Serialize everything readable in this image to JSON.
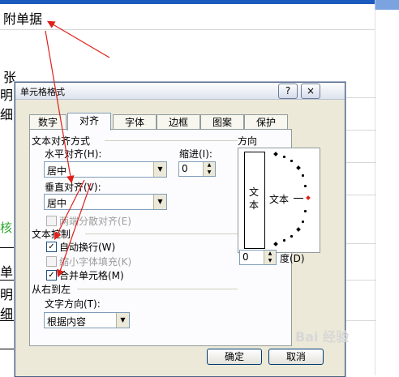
{
  "sheet": {
    "heading": "附单据",
    "cell_zhang": "张",
    "cell_mingxi_fragment": "明细",
    "cell_he": "核",
    "cell_dan": "单",
    "cell_ming_fragment": "明细"
  },
  "dialog": {
    "title": "单元格格式",
    "help_label": "?",
    "close_label": "×",
    "tabs": [
      {
        "label": "数字",
        "active": false
      },
      {
        "label": "对齐",
        "active": true
      },
      {
        "label": "字体",
        "active": false
      },
      {
        "label": "边框",
        "active": false
      },
      {
        "label": "图案",
        "active": false
      },
      {
        "label": "保护",
        "active": false
      }
    ],
    "text_alignment": {
      "section_label": "文本对齐方式",
      "horizontal_label": "水平对齐(H):",
      "horizontal_value": "居中",
      "indent_label": "缩进(I):",
      "indent_value": "0",
      "vertical_label": "垂直对齐(V):",
      "vertical_value": "居中",
      "distributed_label": "两端分散对齐(E)",
      "distributed_checked": false
    },
    "text_control": {
      "section_label": "文本控制",
      "wrap_label": "自动换行(W)",
      "wrap_checked": true,
      "shrink_label": "缩小字体填充(K)",
      "shrink_checked": false,
      "merge_label": "合并单元格(M)",
      "merge_checked": true
    },
    "rtl": {
      "section_label": "从右到左",
      "direction_label": "文字方向(T):",
      "direction_value": "根据内容"
    },
    "orientation": {
      "section_label": "方向",
      "vertical_text": [
        "文",
        "本"
      ],
      "rotated_text": "文本",
      "degree_value": "0",
      "degree_label": "度(D)"
    },
    "ok_label": "确定",
    "cancel_label": "取消"
  },
  "watermark": "Bai 经验",
  "colors": {
    "arrow": "#e0201a",
    "titlebar_border": "#4d6185",
    "dialog_bg": "#ece9d8",
    "green_text": "#2ea82e"
  },
  "icons": {
    "combo_arrow": "▼",
    "spin_up": "▲",
    "spin_down": "▼",
    "check": "✓"
  }
}
